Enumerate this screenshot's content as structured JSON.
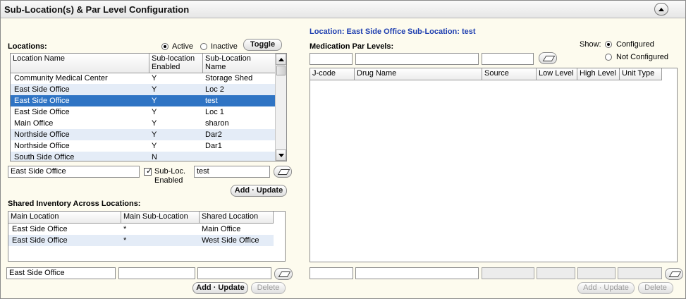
{
  "panel": {
    "title": "Sub-Location(s) & Par Level Configuration"
  },
  "locations": {
    "label": "Locations:",
    "filter": {
      "active_label": "Active",
      "inactive_label": "Inactive",
      "selected": "Active"
    },
    "toggle_label": "Toggle",
    "columns": [
      "Location Name",
      "Sub-location Enabled",
      "Sub-Location Name"
    ],
    "rows": [
      [
        "Community Medical Center",
        "Y",
        "Storage Shed"
      ],
      [
        "East Side Office",
        "Y",
        "Loc 2"
      ],
      [
        "East Side Office",
        "Y",
        "test"
      ],
      [
        "East Side Office",
        "Y",
        "Loc 1"
      ],
      [
        "Main Office",
        "Y",
        "sharon"
      ],
      [
        "Northside Office",
        "Y",
        "Dar2"
      ],
      [
        "Northside Office",
        "Y",
        "Dar1"
      ],
      [
        "South Side Office",
        "N",
        ""
      ]
    ],
    "selected_row": 2,
    "edit": {
      "location_value": "East Side Office",
      "subloc_enabled_label_1": "Sub-Loc.",
      "subloc_enabled_label_2": "Enabled",
      "subloc_enabled_checked": true,
      "sublocation_value": "test",
      "add_update_label": "Add · Update"
    }
  },
  "shared": {
    "label": "Shared Inventory Across Locations:",
    "columns": [
      "Main Location",
      "Main Sub-Location",
      "Shared Location"
    ],
    "rows": [
      [
        "East Side Office",
        "*",
        "Main Office"
      ],
      [
        "East Side Office",
        "*",
        "West Side Office"
      ]
    ],
    "edit": {
      "main_location_value": "East Side Office",
      "main_subloc_value": "",
      "shared_location_value": ""
    },
    "add_update_label": "Add · Update",
    "delete_label": "Delete"
  },
  "medication": {
    "context_location": "Location: East Side Office",
    "context_sublocation": "Sub-Location: test",
    "label": "Medication Par Levels:",
    "show_label": "Show:",
    "configured_label": "Configured",
    "not_configured_label": "Not Configured",
    "show_selected": "Configured",
    "filter_values": [
      "",
      "",
      ""
    ],
    "columns": [
      "J-code",
      "Drug Name",
      "Source",
      "Low Level",
      "High Level",
      "Unit Type"
    ],
    "rows": [],
    "add_update_label": "Add · Update",
    "delete_label": "Delete"
  }
}
